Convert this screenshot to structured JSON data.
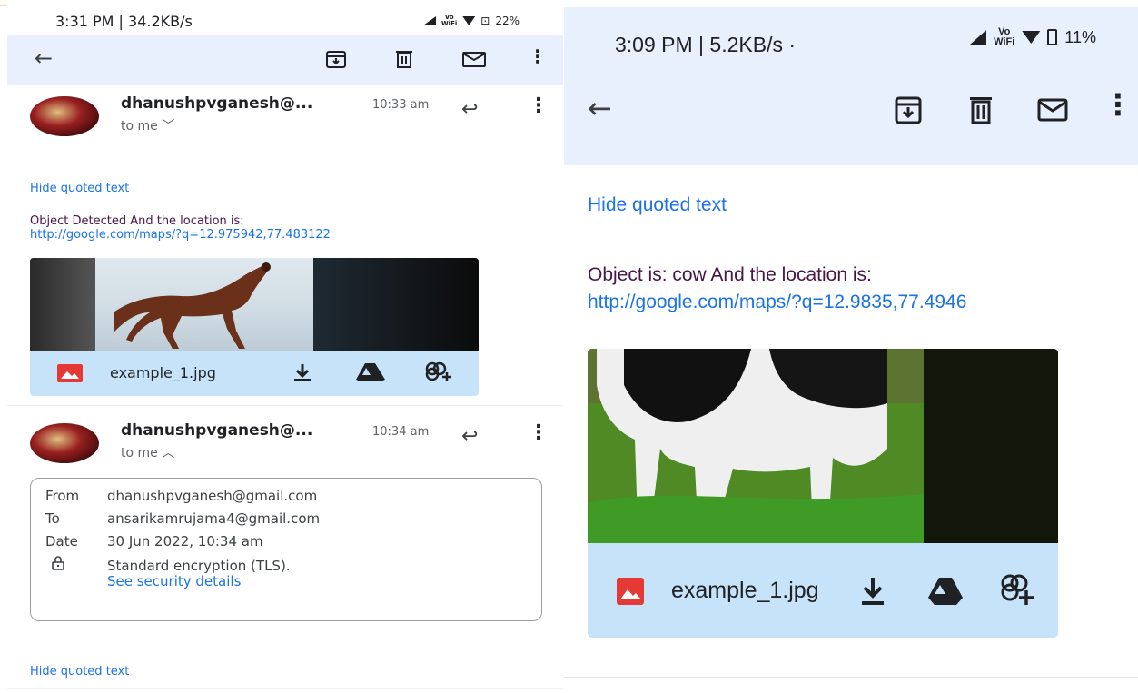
{
  "left": {
    "status": {
      "time": "3:31 PM | 34.2KB/s",
      "network": "Vo WiFi",
      "battery": "22%"
    },
    "toolbar": {
      "icons": [
        "back-arrow-icon",
        "archive-icon",
        "delete-icon",
        "mark-unread-icon",
        "more-vert-icon"
      ]
    },
    "message1": {
      "sender": "dhanushpvganesh@...",
      "time": "10:33 am",
      "to": "to me ﹀",
      "hide_quoted": "Hide quoted text",
      "body_line": "Object Detected And the location is:",
      "link": "http://google.com/maps/?q=12.975942,77.483122",
      "attachment": {
        "filename": "example_1.jpg"
      }
    },
    "message2": {
      "sender": "dhanushpvganesh@...",
      "time": "10:34 am",
      "to": "to me ︿",
      "details": {
        "from_label": "From",
        "from_value": "dhanushpvganesh@gmail.com",
        "to_label": "To",
        "to_value": "ansarikamrujama4@gmail.com",
        "date_label": "Date",
        "date_value": "30 Jun 2022, 10:34 am",
        "security_text": "Standard encryption (TLS).",
        "security_link": "See security details"
      },
      "hide_quoted": "Hide quoted text"
    }
  },
  "right": {
    "status": {
      "time": "3:09 PM | 5.2KB/s ·",
      "network": "Vo WiFi",
      "battery": "11%"
    },
    "hide_quoted": "Hide quoted text",
    "body_line": "Object is: cow And the location is:",
    "link": "http://google.com/maps/?q=12.9835,77.4946",
    "attachment": {
      "filename": "example_1.jpg"
    }
  },
  "colors": {
    "toolbar_bg": "#e8f0fe",
    "attachment_bar": "#c6e3fa",
    "link": "#1a73e8",
    "body_text": "#4a1448",
    "image_icon_red": "#e53935"
  }
}
